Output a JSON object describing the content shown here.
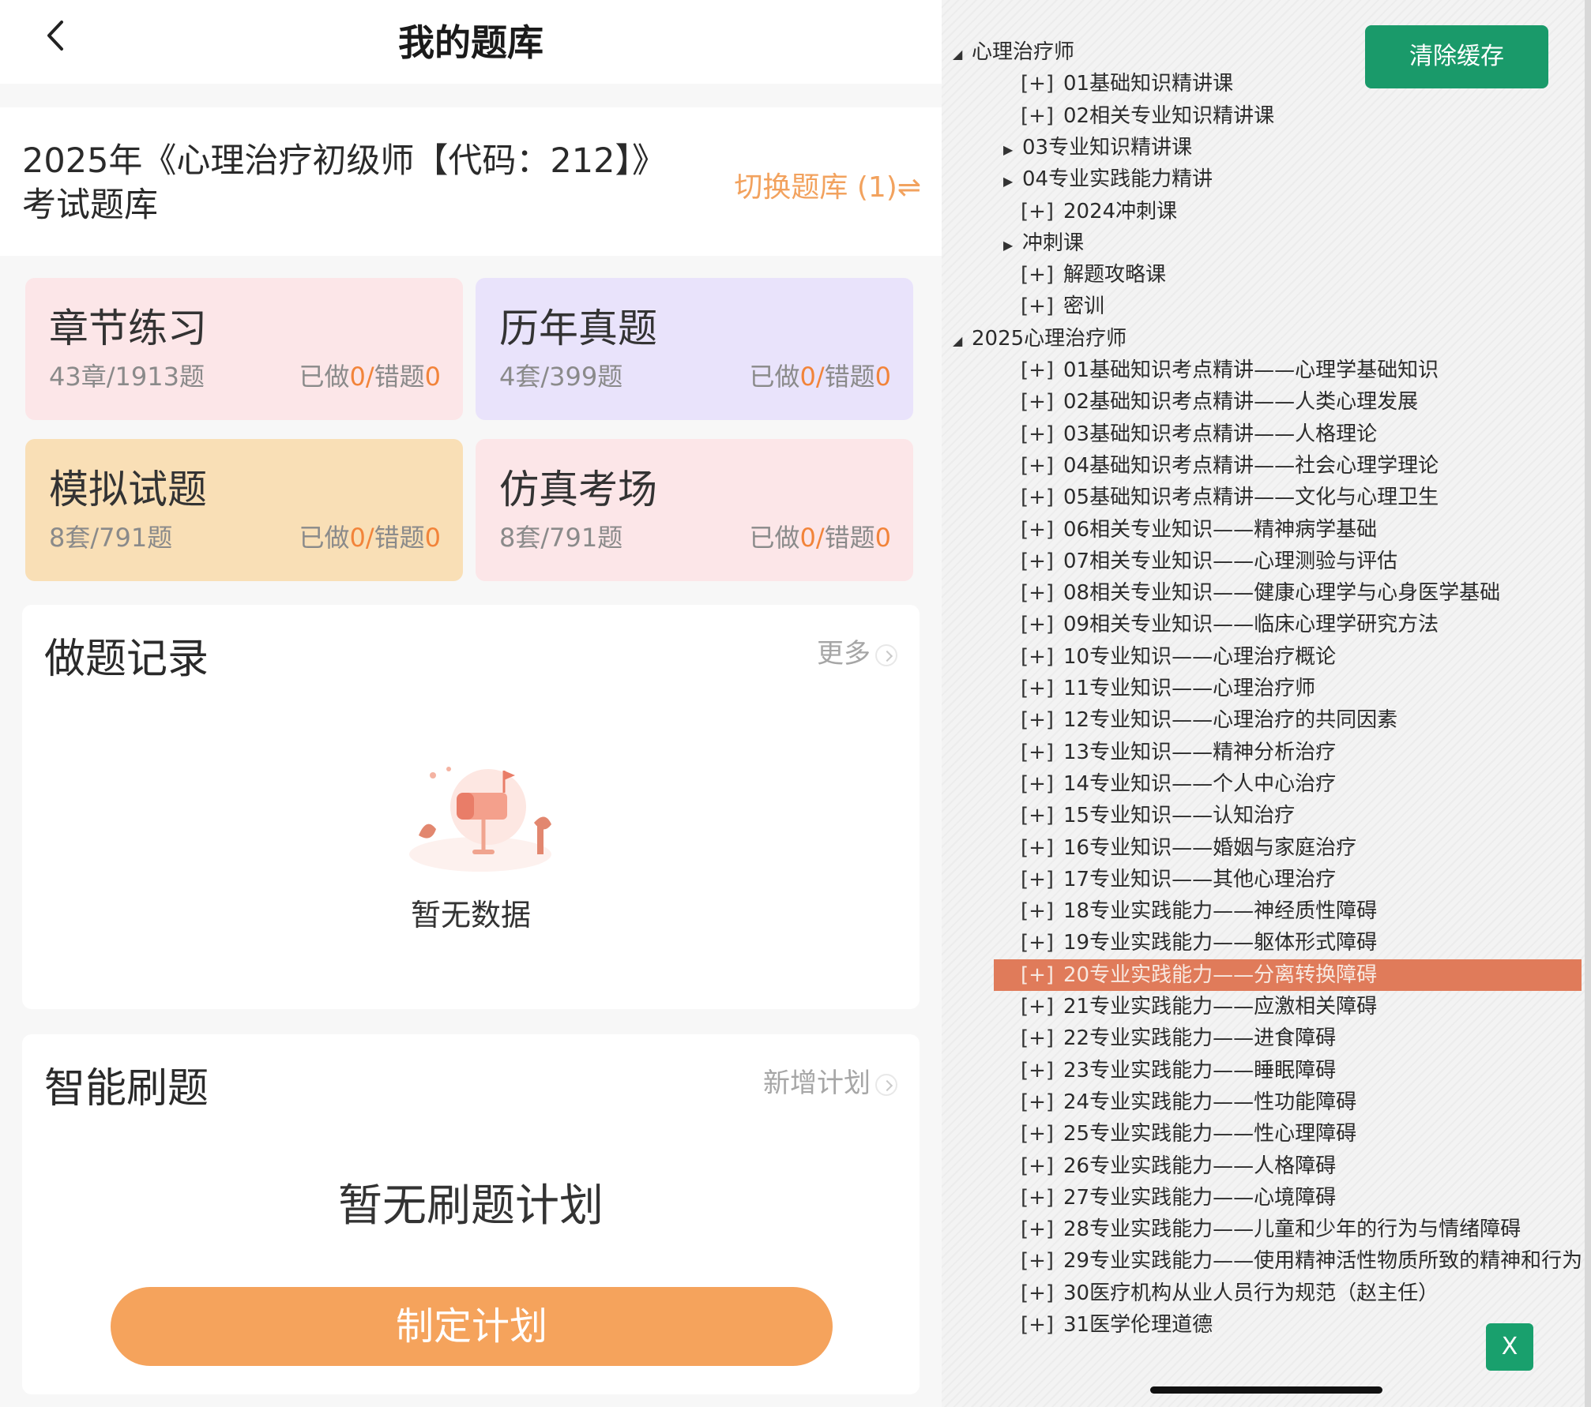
{
  "header": {
    "title": "我的题库"
  },
  "bank": {
    "title_line1": "2025年《心理治疗初级师【代码：212】》",
    "title_line2": "考试题库",
    "switch_label": "切换题库 (1)⇌"
  },
  "cards": [
    {
      "title": "章节练习",
      "count": "43章/1913题",
      "done_label": "已做",
      "done": "0",
      "sep": "/",
      "wrong_label": "错题",
      "wrong": "0",
      "color": "#fce6e8"
    },
    {
      "title": "历年真题",
      "count": "4套/399题",
      "done_label": "已做",
      "done": "0",
      "sep": "/",
      "wrong_label": "错题",
      "wrong": "0",
      "color": "#e9e3fb"
    },
    {
      "title": "模拟试题",
      "count": "8套/791题",
      "done_label": "已做",
      "done": "0",
      "sep": "/",
      "wrong_label": "错题",
      "wrong": "0",
      "color": "#f9dfb6"
    },
    {
      "title": "仿真考场",
      "count": "8套/791题",
      "done_label": "已做",
      "done": "0",
      "sep": "/",
      "wrong_label": "错题",
      "wrong": "0",
      "color": "#fce6e8"
    }
  ],
  "records": {
    "title": "做题记录",
    "more": "更多",
    "empty": "暂无数据"
  },
  "smart": {
    "title": "智能刷题",
    "add_plan": "新增计划",
    "empty": "暂无刷题计划",
    "button": "制定计划"
  },
  "tree": {
    "clear_cache": "清除缓存",
    "close": "X",
    "highlight_color": "#e07b5a",
    "items": [
      {
        "toggle": "◢",
        "plus": "",
        "text": "心理治疗师"
      },
      {
        "toggle": "",
        "plus": "[+]",
        "text": "01基础知识精讲课"
      },
      {
        "toggle": "",
        "plus": "[+]",
        "text": "02相关专业知识精讲课"
      },
      {
        "toggle": "▶",
        "plus": "",
        "text": "03专业知识精讲课"
      },
      {
        "toggle": "▶",
        "plus": "",
        "text": "04专业实践能力精讲"
      },
      {
        "toggle": "",
        "plus": "[+]",
        "text": "2024冲刺课"
      },
      {
        "toggle": "▶",
        "plus": "",
        "text": "冲刺课"
      },
      {
        "toggle": "",
        "plus": "[+]",
        "text": "解题攻略课"
      },
      {
        "toggle": "",
        "plus": "[+]",
        "text": "密训"
      },
      {
        "toggle": "◢",
        "plus": "",
        "text": "2025心理治疗师"
      },
      {
        "toggle": "",
        "plus": "[+]",
        "text": "01基础知识考点精讲——心理学基础知识"
      },
      {
        "toggle": "",
        "plus": "[+]",
        "text": "02基础知识考点精讲——人类心理发展"
      },
      {
        "toggle": "",
        "plus": "[+]",
        "text": "03基础知识考点精讲——人格理论"
      },
      {
        "toggle": "",
        "plus": "[+]",
        "text": "04基础知识考点精讲——社会心理学理论"
      },
      {
        "toggle": "",
        "plus": "[+]",
        "text": "05基础知识考点精讲——文化与心理卫生"
      },
      {
        "toggle": "",
        "plus": "[+]",
        "text": "06相关专业知识——精神病学基础"
      },
      {
        "toggle": "",
        "plus": "[+]",
        "text": "07相关专业知识——心理测验与评估"
      },
      {
        "toggle": "",
        "plus": "[+]",
        "text": "08相关专业知识——健康心理学与心身医学基础"
      },
      {
        "toggle": "",
        "plus": "[+]",
        "text": "09相关专业知识——临床心理学研究方法"
      },
      {
        "toggle": "",
        "plus": "[+]",
        "text": "10专业知识——心理治疗概论"
      },
      {
        "toggle": "",
        "plus": "[+]",
        "text": "11专业知识——心理治疗师"
      },
      {
        "toggle": "",
        "plus": "[+]",
        "text": "12专业知识——心理治疗的共同因素"
      },
      {
        "toggle": "",
        "plus": "[+]",
        "text": "13专业知识——精神分析治疗"
      },
      {
        "toggle": "",
        "plus": "[+]",
        "text": "14专业知识——个人中心治疗"
      },
      {
        "toggle": "",
        "plus": "[+]",
        "text": "15专业知识——认知治疗"
      },
      {
        "toggle": "",
        "plus": "[+]",
        "text": "16专业知识——婚姻与家庭治疗"
      },
      {
        "toggle": "",
        "plus": "[+]",
        "text": "17专业知识——其他心理治疗"
      },
      {
        "toggle": "",
        "plus": "[+]",
        "text": "18专业实践能力——神经质性障碍"
      },
      {
        "toggle": "",
        "plus": "[+]",
        "text": "19专业实践能力——躯体形式障碍"
      },
      {
        "toggle": "",
        "plus": "[+]",
        "text": "20专业实践能力——分离转换障碍",
        "selected": true
      },
      {
        "toggle": "",
        "plus": "[+]",
        "text": "21专业实践能力——应激相关障碍"
      },
      {
        "toggle": "",
        "plus": "[+]",
        "text": "22专业实践能力——进食障碍"
      },
      {
        "toggle": "",
        "plus": "[+]",
        "text": "23专业实践能力——睡眠障碍"
      },
      {
        "toggle": "",
        "plus": "[+]",
        "text": "24专业实践能力——性功能障碍"
      },
      {
        "toggle": "",
        "plus": "[+]",
        "text": "25专业实践能力——性心理障碍"
      },
      {
        "toggle": "",
        "plus": "[+]",
        "text": "26专业实践能力——人格障碍"
      },
      {
        "toggle": "",
        "plus": "[+]",
        "text": "27专业实践能力——心境障碍"
      },
      {
        "toggle": "",
        "plus": "[+]",
        "text": "28专业实践能力——儿童和少年的行为与情绪障碍"
      },
      {
        "toggle": "",
        "plus": "[+]",
        "text": "29专业实践能力——使用精神活性物质所致的精神和行为"
      },
      {
        "toggle": "",
        "plus": "[+]",
        "text": "30医疗机构从业人员行为规范（赵主任）"
      },
      {
        "toggle": "",
        "plus": "[+]",
        "text": "31医学伦理道德"
      }
    ]
  }
}
